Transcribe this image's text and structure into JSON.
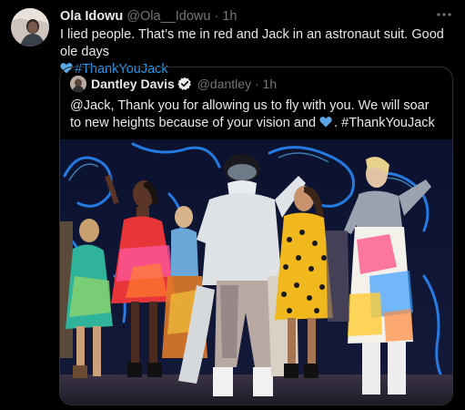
{
  "tweet": {
    "author_name": "Ola Idowu",
    "author_handle": "@Ola__Idowu",
    "separator": "·",
    "time": "1h",
    "text_line1": "I lied people. That’s me in red and Jack in an astronaut suit. Good ole days",
    "hashtag": "#ThankYouJack"
  },
  "quoted_tweet": {
    "author_name": "Dantley Davis",
    "author_handle": "@dantley",
    "separator": "·",
    "time": "1h",
    "text_before_heart": "@Jack, Thank you for allowing us to fly with you. We will soar to new heights because of your vision and",
    "text_after_heart": ". #ThankYouJack"
  },
  "icons": {
    "more": "more-horizontal-icon",
    "heart": "blue-heart-icon",
    "verified": "verified-badge-icon"
  },
  "colors": {
    "background": "#000000",
    "text": "#e7e9ea",
    "muted": "#71767b",
    "accent": "#1d9bf0",
    "border": "#2f3336"
  }
}
